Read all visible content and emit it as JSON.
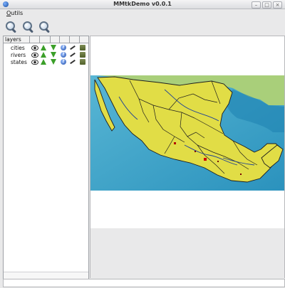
{
  "window": {
    "title": "MMtkDemo v0.0.1"
  },
  "menu": {
    "items": [
      "Outils"
    ]
  },
  "toolbar": {
    "tools": [
      "zoom-in-icon",
      "zoom-out-icon",
      "zoom-extent-icon"
    ]
  },
  "layers": {
    "header": "layers",
    "items": [
      {
        "name": "cities"
      },
      {
        "name": "rivers"
      },
      {
        "name": "states"
      }
    ]
  },
  "colors": {
    "sea": "#58b6d4",
    "deep_sea": "#1f83b2",
    "land": "#e1dd46",
    "border": "#1d1d1d",
    "river": "#1b3f99"
  }
}
